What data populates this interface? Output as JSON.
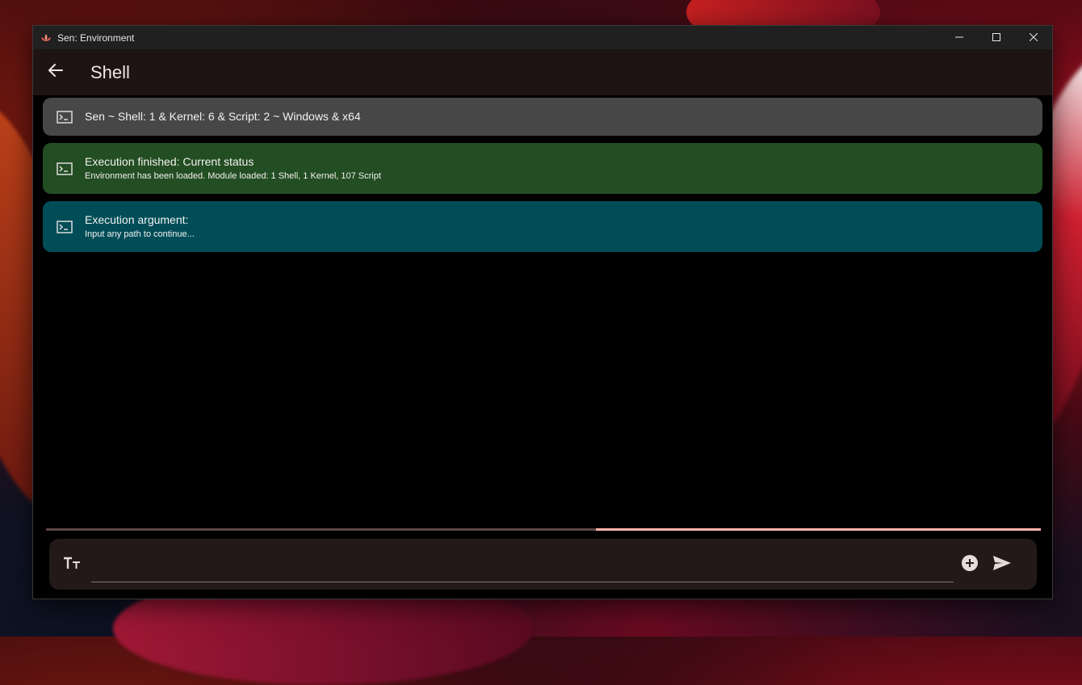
{
  "window": {
    "title": "Sen: Environment",
    "app_icon": "lotus-icon",
    "controls": [
      "minimize-icon",
      "maximize-icon",
      "close-icon"
    ]
  },
  "appbar": {
    "back_icon": "arrow-left-icon",
    "title": "Shell"
  },
  "messages": [
    {
      "icon": "terminal-icon",
      "title": "Sen ~ Shell: 1 & Kernel: 6 & Script: 2 ~ Windows & x64",
      "subtitle": "",
      "color": "#474747"
    },
    {
      "icon": "terminal-icon",
      "title": "Execution finished: Current status",
      "subtitle": "Environment has been loaded. Module loaded: 1 Shell, 1 Kernel, 107 Script",
      "color": "#234d22"
    },
    {
      "icon": "terminal-icon",
      "title": "Execution argument:",
      "subtitle": "Input any path to continue...",
      "color": "#004d57"
    }
  ],
  "progress": {
    "indeterminate": true,
    "track_color": "#5e4541",
    "fill_color": "#ffb4a8",
    "fill_start": 0.553,
    "fill_end": 1.0
  },
  "composer": {
    "font_icon": "text-size-icon",
    "input_value": "",
    "input_placeholder": "",
    "add_icon": "add-circle-icon",
    "send_icon": "send-icon"
  },
  "colors": {
    "appbar_bg": "#1e1413",
    "composer_bg": "#231918",
    "accent": "#ffb4a8"
  }
}
